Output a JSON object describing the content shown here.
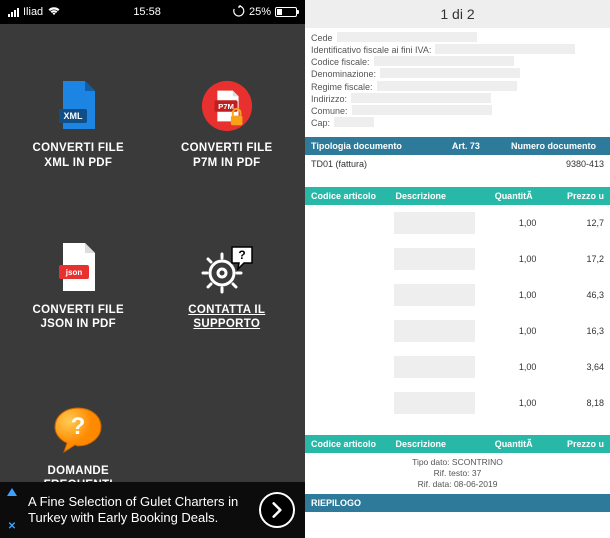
{
  "statusbar": {
    "carrier": "Iliad",
    "time": "15:58",
    "battery_pct": "25%"
  },
  "tiles": [
    {
      "label": "CONVERTI FILE\nXML IN PDF"
    },
    {
      "label": "CONVERTI FILE\nP7M IN PDF"
    },
    {
      "label": "CONVERTI FILE\nJSON IN PDF"
    },
    {
      "label": "CONTATTA IL\nSUPPORTO"
    },
    {
      "label": "DOMANDE\nFREQUENTI"
    }
  ],
  "ad": {
    "text": "A Fine Selection of Gulet Charters in Turkey with Early Booking Deals."
  },
  "doc": {
    "pager": "1 di 2",
    "meta_labels": {
      "ced": "Cede",
      "idiva": "Identificativo fiscale ai fini IVA:",
      "cf": "Codice fiscale:",
      "den": "Denominazione:",
      "reg": "Regime fiscale:",
      "ind": "Indirizzo:",
      "com": "Comune:",
      "cap": "Cap:"
    },
    "header": {
      "c1": "Tipologia documento",
      "c2": "Art. 73",
      "c3": "Numero documento"
    },
    "header_row": {
      "c1": "TD01 (fattura)",
      "c2": "",
      "c3": "9380-413"
    },
    "sub": {
      "s1": "Codice articolo",
      "s2": "Descrizione",
      "s3": "QuantitÃ",
      "s4": "Prezzo u"
    },
    "items": [
      {
        "qty": "1,00",
        "price": "12,7"
      },
      {
        "qty": "1,00",
        "price": "17,2"
      },
      {
        "qty": "1,00",
        "price": "46,3"
      },
      {
        "qty": "1,00",
        "price": "16,3"
      },
      {
        "qty": "1,00",
        "price": "3,64"
      },
      {
        "qty": "1,00",
        "price": "8,18"
      }
    ],
    "foot": {
      "l1": "Tipo dato: SCONTRINO",
      "l2": "Rif. testo: 37",
      "l3": "Rif. data: 08-06-2019"
    },
    "riepilogo": "RIEPILOGO"
  }
}
